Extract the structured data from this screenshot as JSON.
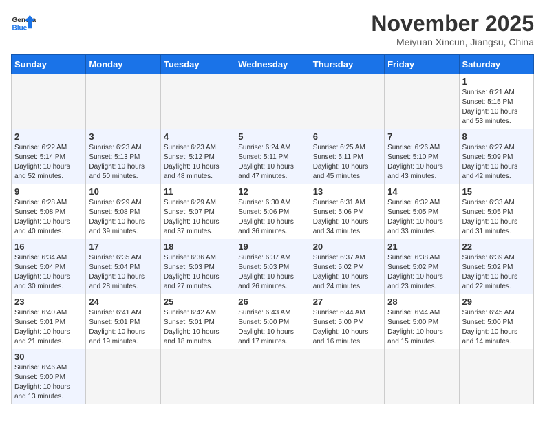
{
  "header": {
    "logo_general": "General",
    "logo_blue": "Blue",
    "month": "November 2025",
    "location": "Meiyuan Xincun, Jiangsu, China"
  },
  "days_of_week": [
    "Sunday",
    "Monday",
    "Tuesday",
    "Wednesday",
    "Thursday",
    "Friday",
    "Saturday"
  ],
  "weeks": [
    [
      {
        "day": "",
        "info": ""
      },
      {
        "day": "",
        "info": ""
      },
      {
        "day": "",
        "info": ""
      },
      {
        "day": "",
        "info": ""
      },
      {
        "day": "",
        "info": ""
      },
      {
        "day": "",
        "info": ""
      },
      {
        "day": "1",
        "info": "Sunrise: 6:21 AM\nSunset: 5:15 PM\nDaylight: 10 hours and 53 minutes."
      }
    ],
    [
      {
        "day": "2",
        "info": "Sunrise: 6:22 AM\nSunset: 5:14 PM\nDaylight: 10 hours and 52 minutes."
      },
      {
        "day": "3",
        "info": "Sunrise: 6:23 AM\nSunset: 5:13 PM\nDaylight: 10 hours and 50 minutes."
      },
      {
        "day": "4",
        "info": "Sunrise: 6:23 AM\nSunset: 5:12 PM\nDaylight: 10 hours and 48 minutes."
      },
      {
        "day": "5",
        "info": "Sunrise: 6:24 AM\nSunset: 5:11 PM\nDaylight: 10 hours and 47 minutes."
      },
      {
        "day": "6",
        "info": "Sunrise: 6:25 AM\nSunset: 5:11 PM\nDaylight: 10 hours and 45 minutes."
      },
      {
        "day": "7",
        "info": "Sunrise: 6:26 AM\nSunset: 5:10 PM\nDaylight: 10 hours and 43 minutes."
      },
      {
        "day": "8",
        "info": "Sunrise: 6:27 AM\nSunset: 5:09 PM\nDaylight: 10 hours and 42 minutes."
      }
    ],
    [
      {
        "day": "9",
        "info": "Sunrise: 6:28 AM\nSunset: 5:08 PM\nDaylight: 10 hours and 40 minutes."
      },
      {
        "day": "10",
        "info": "Sunrise: 6:29 AM\nSunset: 5:08 PM\nDaylight: 10 hours and 39 minutes."
      },
      {
        "day": "11",
        "info": "Sunrise: 6:29 AM\nSunset: 5:07 PM\nDaylight: 10 hours and 37 minutes."
      },
      {
        "day": "12",
        "info": "Sunrise: 6:30 AM\nSunset: 5:06 PM\nDaylight: 10 hours and 36 minutes."
      },
      {
        "day": "13",
        "info": "Sunrise: 6:31 AM\nSunset: 5:06 PM\nDaylight: 10 hours and 34 minutes."
      },
      {
        "day": "14",
        "info": "Sunrise: 6:32 AM\nSunset: 5:05 PM\nDaylight: 10 hours and 33 minutes."
      },
      {
        "day": "15",
        "info": "Sunrise: 6:33 AM\nSunset: 5:05 PM\nDaylight: 10 hours and 31 minutes."
      }
    ],
    [
      {
        "day": "16",
        "info": "Sunrise: 6:34 AM\nSunset: 5:04 PM\nDaylight: 10 hours and 30 minutes."
      },
      {
        "day": "17",
        "info": "Sunrise: 6:35 AM\nSunset: 5:04 PM\nDaylight: 10 hours and 28 minutes."
      },
      {
        "day": "18",
        "info": "Sunrise: 6:36 AM\nSunset: 5:03 PM\nDaylight: 10 hours and 27 minutes."
      },
      {
        "day": "19",
        "info": "Sunrise: 6:37 AM\nSunset: 5:03 PM\nDaylight: 10 hours and 26 minutes."
      },
      {
        "day": "20",
        "info": "Sunrise: 6:37 AM\nSunset: 5:02 PM\nDaylight: 10 hours and 24 minutes."
      },
      {
        "day": "21",
        "info": "Sunrise: 6:38 AM\nSunset: 5:02 PM\nDaylight: 10 hours and 23 minutes."
      },
      {
        "day": "22",
        "info": "Sunrise: 6:39 AM\nSunset: 5:02 PM\nDaylight: 10 hours and 22 minutes."
      }
    ],
    [
      {
        "day": "23",
        "info": "Sunrise: 6:40 AM\nSunset: 5:01 PM\nDaylight: 10 hours and 21 minutes."
      },
      {
        "day": "24",
        "info": "Sunrise: 6:41 AM\nSunset: 5:01 PM\nDaylight: 10 hours and 19 minutes."
      },
      {
        "day": "25",
        "info": "Sunrise: 6:42 AM\nSunset: 5:01 PM\nDaylight: 10 hours and 18 minutes."
      },
      {
        "day": "26",
        "info": "Sunrise: 6:43 AM\nSunset: 5:00 PM\nDaylight: 10 hours and 17 minutes."
      },
      {
        "day": "27",
        "info": "Sunrise: 6:44 AM\nSunset: 5:00 PM\nDaylight: 10 hours and 16 minutes."
      },
      {
        "day": "28",
        "info": "Sunrise: 6:44 AM\nSunset: 5:00 PM\nDaylight: 10 hours and 15 minutes."
      },
      {
        "day": "29",
        "info": "Sunrise: 6:45 AM\nSunset: 5:00 PM\nDaylight: 10 hours and 14 minutes."
      }
    ],
    [
      {
        "day": "30",
        "info": "Sunrise: 6:46 AM\nSunset: 5:00 PM\nDaylight: 10 hours and 13 minutes."
      },
      {
        "day": "",
        "info": ""
      },
      {
        "day": "",
        "info": ""
      },
      {
        "day": "",
        "info": ""
      },
      {
        "day": "",
        "info": ""
      },
      {
        "day": "",
        "info": ""
      },
      {
        "day": "",
        "info": ""
      }
    ]
  ]
}
